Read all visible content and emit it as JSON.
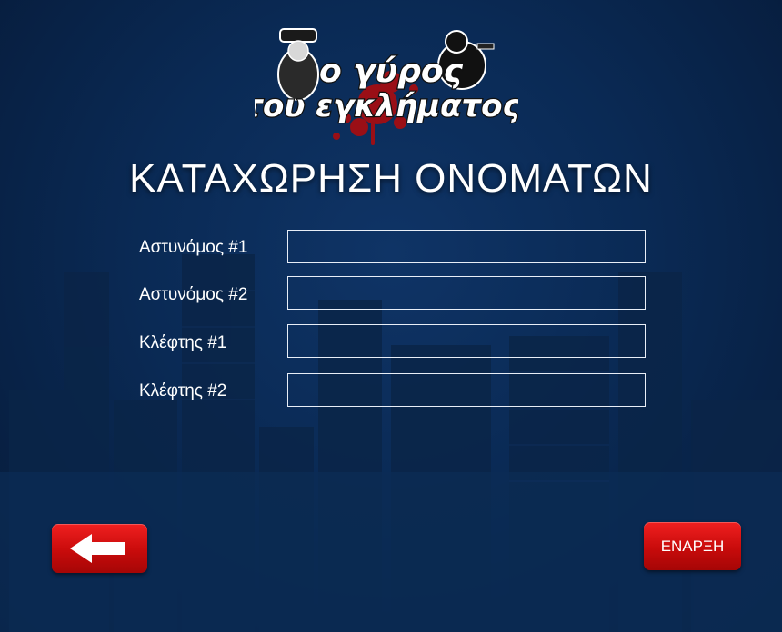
{
  "logo": {
    "line1": "ο γύρος",
    "line2": "του εγκλήματος"
  },
  "title": "ΚΑΤΑΧΩΡΗΣΗ ΟΝΟΜΑΤΩΝ",
  "fields": [
    {
      "label": "Αστυνόμος #1",
      "value": ""
    },
    {
      "label": "Αστυνόμος #2",
      "value": ""
    },
    {
      "label": "Κλέφτης #1",
      "value": ""
    },
    {
      "label": "Κλέφτης #2",
      "value": ""
    }
  ],
  "buttons": {
    "back_icon": "arrow-left-icon",
    "start_label": "ΕΝΑΡΞΗ"
  },
  "colors": {
    "button_red": "#e01212",
    "background": "#0a2a55",
    "text": "#ffffff"
  }
}
